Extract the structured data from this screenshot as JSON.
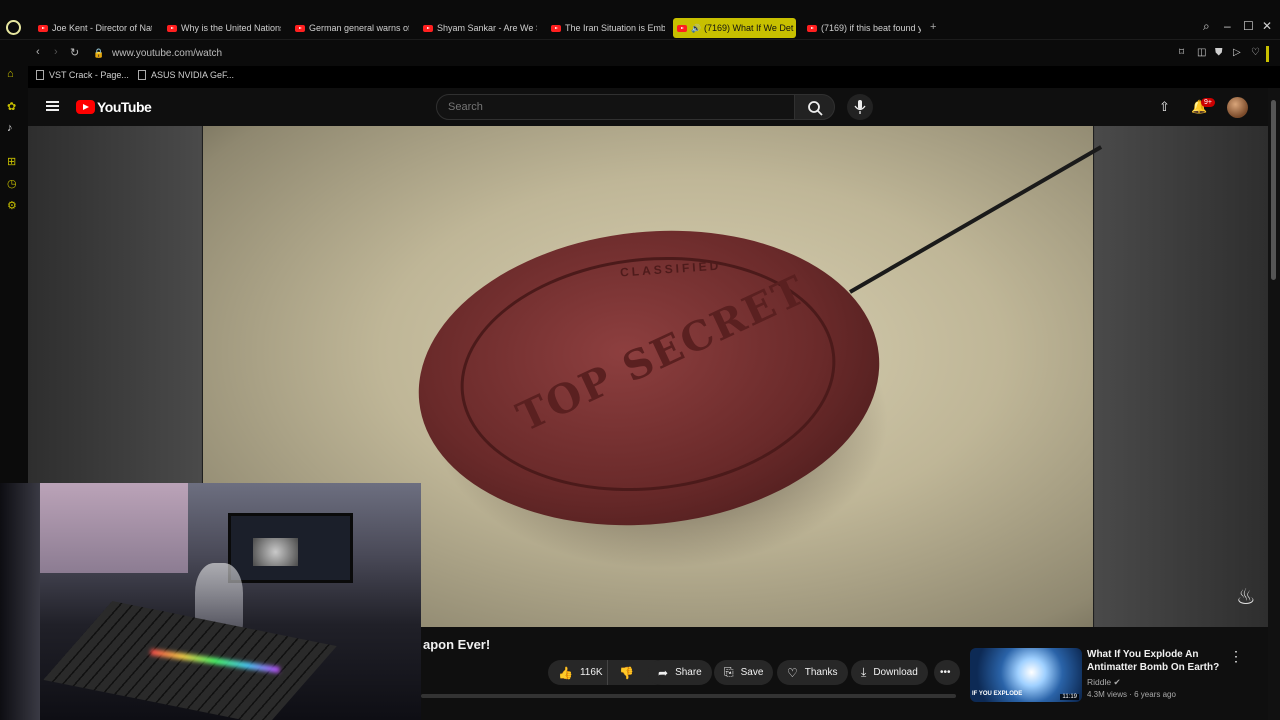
{
  "browser": {
    "tabs": [
      {
        "label": "Joe Kent - Director of Nati",
        "active": false
      },
      {
        "label": "Why is the United Nations",
        "active": false
      },
      {
        "label": "German general warns of",
        "active": false
      },
      {
        "label": "Shyam Sankar - Are We S",
        "active": false
      },
      {
        "label": "The Iran Situation is Emba",
        "active": false
      },
      {
        "label": "(7169) What If We Det",
        "active": true
      },
      {
        "label": "(7169) if this beat found yo",
        "active": false
      }
    ],
    "url": "www.youtube.com/watch",
    "bookmarks": [
      "VST Crack - Page...",
      "ASUS NVIDIA GeF..."
    ],
    "accent_color": "#c8c000"
  },
  "youtube": {
    "logo_text": "YouTube",
    "search_placeholder": "Search",
    "notification_count": "9+",
    "video_title_visible": "apon Ever!",
    "actions": {
      "likes": "116K",
      "share": "Share",
      "save": "Save",
      "thanks": "Thanks",
      "download": "Download"
    },
    "suggestion": {
      "title": "What If You Explode An Antimatter Bomb On Earth?",
      "channel": "Riddle",
      "meta": "4.3M views · 6 years ago",
      "duration": "11:19",
      "thumb_text": "IF YOU EXPLODE"
    },
    "video_frame": {
      "seal_main_text": "TOP SECRET",
      "seal_ring_text": "CLASSIFIED"
    }
  }
}
